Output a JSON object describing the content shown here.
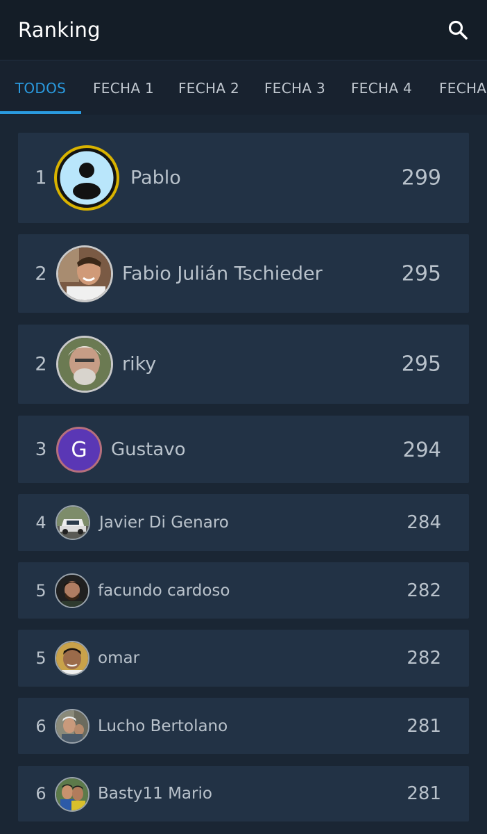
{
  "appbar": {
    "title": "Ranking",
    "search_icon": "search-icon"
  },
  "tabs": [
    {
      "label": "TODOS",
      "active": true
    },
    {
      "label": "FECHA 1"
    },
    {
      "label": "FECHA 2"
    },
    {
      "label": "FECHA 3"
    },
    {
      "label": "FECHA 4"
    },
    {
      "label": "FECHA"
    }
  ],
  "colors": {
    "accent": "#2a9be0",
    "card": "#223245",
    "background": "#1a2634"
  },
  "ranking": [
    {
      "position": "1",
      "name": "Pablo",
      "score": "299"
    },
    {
      "position": "2",
      "name": "Fabio Julián Tschieder",
      "score": "295"
    },
    {
      "position": "2",
      "name": "riky",
      "score": "295"
    },
    {
      "position": "3",
      "name": "Gustavo",
      "score": "294",
      "avatar_letter": "G"
    },
    {
      "position": "4",
      "name": "Javier Di Genaro",
      "score": "284"
    },
    {
      "position": "5",
      "name": "facundo cardoso",
      "score": "282"
    },
    {
      "position": "5",
      "name": "omar",
      "score": "282"
    },
    {
      "position": "6",
      "name": "Lucho Bertolano",
      "score": "281"
    },
    {
      "position": "6",
      "name": "Basty11 Mario",
      "score": "281"
    }
  ]
}
